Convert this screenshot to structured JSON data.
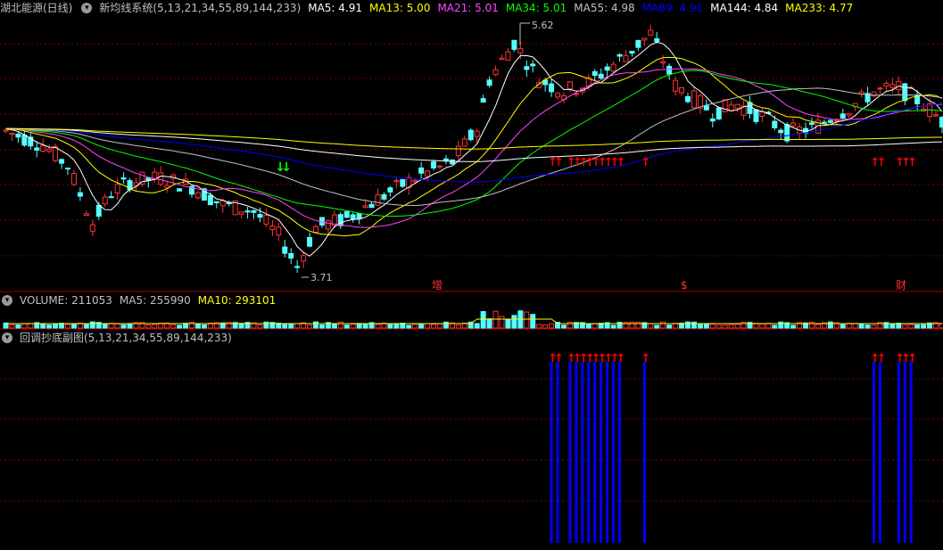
{
  "main": {
    "stock_name": "湖北能源(日线)",
    "indicator_name": "新均线系统(5,13,21,34,55,89,144,233)",
    "ma_values": [
      {
        "label": "MA5: 4.91",
        "color": "#ffffff"
      },
      {
        "label": "MA13: 5.00",
        "color": "#ffff00"
      },
      {
        "label": "MA21: 5.01",
        "color": "#ff44ff"
      },
      {
        "label": "MA34: 5.01",
        "color": "#00ff00"
      },
      {
        "label": "MA55: 4.98",
        "color": "#c0c0c0"
      },
      {
        "label": "MA89: 4.91",
        "color": "#0000ff"
      },
      {
        "label": "MA144: 4.84",
        "color": "#ffffff"
      },
      {
        "label": "MA233: 4.77",
        "color": "#ffff00"
      }
    ],
    "high_label": "5.62",
    "low_label": "3.71",
    "event_markers": [
      "增",
      "$",
      "财"
    ]
  },
  "volume": {
    "title": "VOLUME: 211053",
    "ma5": "MA5: 255990",
    "ma10": "MA10: 293101"
  },
  "sub": {
    "title": "回调抄底副图(5,13,21,34,55,89,144,233)"
  },
  "colors": {
    "up": "#ff3232",
    "down": "#54ffff",
    "grid": "#7a0000",
    "signal_bar": "#0000ff",
    "signal_arrow": "#ff0000",
    "buy_arrow": "#00ff00"
  },
  "chart_data": {
    "type": "candlestick",
    "price_high": 5.62,
    "price_low": 3.71,
    "signal_days": [
      88,
      89,
      91,
      92,
      93,
      94,
      95,
      96,
      97,
      98,
      99,
      103,
      140,
      141,
      144,
      145,
      146
    ],
    "buy_arrow_days": [
      44,
      45
    ]
  }
}
